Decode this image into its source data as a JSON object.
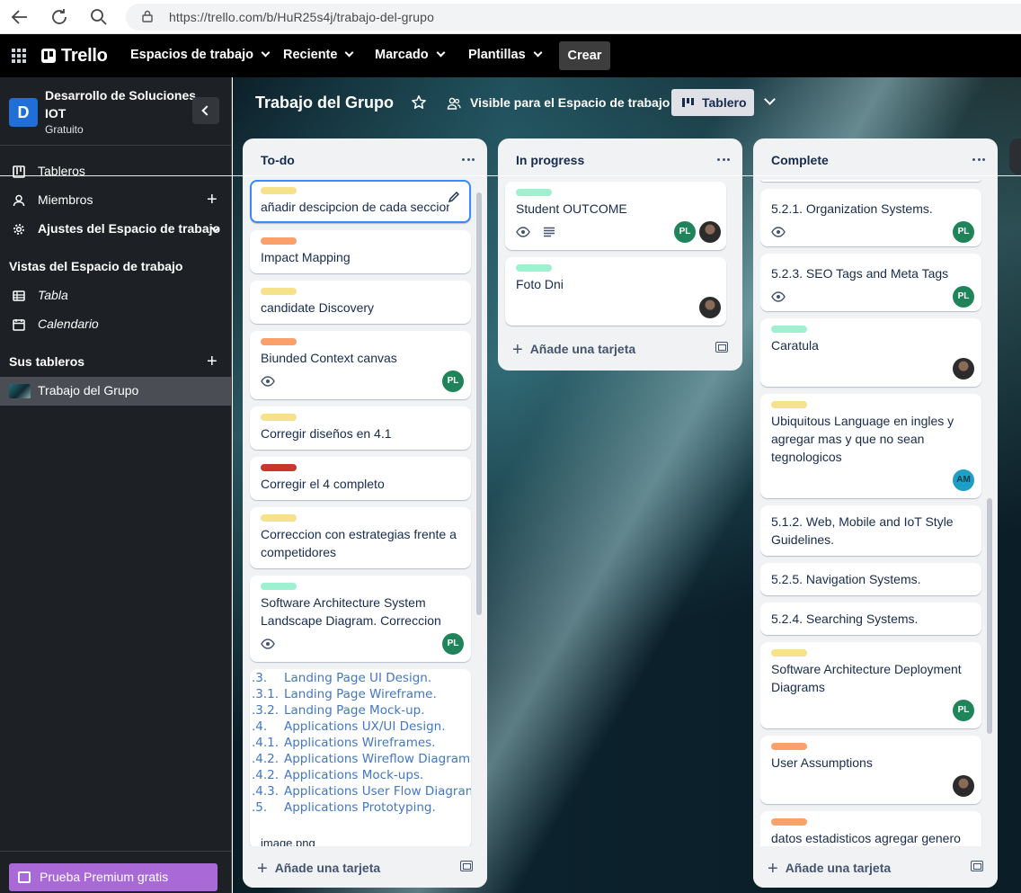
{
  "browser": {
    "url": "https://trello.com/b/HuR25s4j/trabajo-del-grupo"
  },
  "header": {
    "brand": "Trello",
    "menus": [
      "Espacios de trabajo",
      "Reciente",
      "Marcado",
      "Plantillas"
    ],
    "create_label": "Crear"
  },
  "sidebar": {
    "workspace_initial": "D",
    "workspace_name": "Desarrollo de Soluciones IOT",
    "workspace_plan": "Gratuito",
    "items": [
      {
        "label": "Tableros"
      },
      {
        "label": "Miembros"
      },
      {
        "label": "Ajustes del Espacio de trabajo"
      }
    ],
    "views_heading": "Vistas del Espacio de trabajo",
    "views": [
      {
        "label": "Tabla"
      },
      {
        "label": "Calendario"
      }
    ],
    "boards_heading": "Sus tableros",
    "boards": [
      {
        "label": "Trabajo del Grupo"
      }
    ],
    "premium_label": "Prueba Premium gratis"
  },
  "board": {
    "title": "Trabajo del Grupo",
    "visibility": "Visible para el Espacio de trabajo",
    "view_label": "Tablero"
  },
  "colors": {
    "yellow": "#f5e28b",
    "orange": "#fca06b",
    "red": "#c9372c",
    "green": "#9df0d0",
    "member_green": "#1f845a"
  },
  "lists": [
    {
      "title": "To-do",
      "add_card": "Añade una tarjeta",
      "cards": [
        {
          "label": "yellow",
          "title": "añadir descipcion de cada seccion"
        },
        {
          "label": "orange",
          "title": "Impact Mapping"
        },
        {
          "label": "yellow",
          "title": "candidate Discovery"
        },
        {
          "label": "orange",
          "title": "Biunded Context canvas",
          "member": "PL"
        },
        {
          "label": "yellow",
          "title": "Corregir diseños en 4.1"
        },
        {
          "label": "red",
          "title": "Corregir el 4 completo"
        },
        {
          "label": "yellow",
          "title": "Correccion con estrategias frente a competidores"
        },
        {
          "label": "green",
          "title": "Software Architecture System Landscape Diagram. Correccion",
          "member": "PL"
        }
      ],
      "cover_card": {
        "lines": [
          {
            "num": ".3.",
            "text": "Landing Page UI Design."
          },
          {
            "num": ".3.1.",
            "text": "Landing Page Wireframe."
          },
          {
            "num": ".3.2.",
            "text": "Landing Page Mock-up."
          },
          {
            "num": ".4.",
            "text": "Applications UX/UI Design."
          },
          {
            "num": ".4.1.",
            "text": "Applications Wireframes."
          },
          {
            "num": ".4.2.",
            "text": "Applications Wireflow Diagrams."
          },
          {
            "num": ".4.2.",
            "text": "Applications Mock-ups."
          },
          {
            "num": ".4.3.",
            "text": "Applications User Flow Diagrams."
          },
          {
            "num": ".5.",
            "text": "Applications Prototyping."
          }
        ],
        "filename": "image.png"
      }
    },
    {
      "title": "In progress",
      "add_card": "Añade una tarjeta",
      "cards": [
        {
          "label": "green",
          "title": "Student OUTCOME",
          "member": "PL"
        },
        {
          "label": "green",
          "title": "Foto Dni"
        }
      ]
    },
    {
      "title": "Complete",
      "add_card": "Añade una tarjeta",
      "cards": [
        {
          "title": "5.2.1. Organization Systems.",
          "member": "PL"
        },
        {
          "title": "5.2.3. SEO Tags and Meta Tags",
          "member": "PL"
        },
        {
          "label": "green",
          "title": "Caratula"
        },
        {
          "label": "yellow",
          "title": "Ubiquitous Language en ingles y agregar mas y que no sean tegnologicos",
          "member": "AM"
        },
        {
          "title": "5.1.2. Web, Mobile and IoT Style Guidelines."
        },
        {
          "title": "5.2.5. Navigation Systems."
        },
        {
          "title": "5.2.4. Searching Systems."
        },
        {
          "label": "yellow",
          "title": "Software Architecture Deployment Diagrams",
          "member": "PL"
        },
        {
          "label": "orange",
          "title": "User Assumptions"
        },
        {
          "label": "orange",
          "title": "datos estadisticos agregar genero"
        }
      ]
    }
  ]
}
